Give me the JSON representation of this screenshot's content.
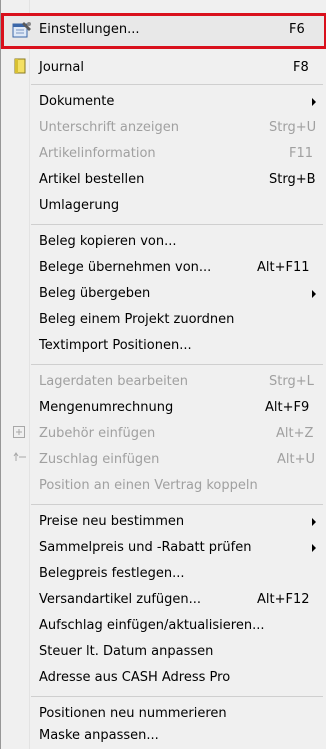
{
  "menu": {
    "items": [
      {
        "label": "Einstellungen...",
        "shortcut": "F6"
      },
      {
        "label": "Journal",
        "shortcut": "F8"
      },
      {
        "label": "Dokumente"
      },
      {
        "label": "Unterschrift anzeigen",
        "shortcut": "Strg+U"
      },
      {
        "label": "Artikelinformation",
        "shortcut": "F11"
      },
      {
        "label": "Artikel bestellen",
        "shortcut": "Strg+B"
      },
      {
        "label": "Umlagerung"
      },
      {
        "label": "Beleg kopieren von..."
      },
      {
        "label": "Belege übernehmen von...",
        "shortcut": "Alt+F11"
      },
      {
        "label": "Beleg übergeben"
      },
      {
        "label": "Beleg einem Projekt zuordnen"
      },
      {
        "label": "Textimport Positionen..."
      },
      {
        "label": "Lagerdaten bearbeiten",
        "shortcut": "Strg+L"
      },
      {
        "label": "Mengenumrechnung",
        "shortcut": "Alt+F9"
      },
      {
        "label": "Zubehör einfügen",
        "shortcut": "Alt+Z"
      },
      {
        "label": "Zuschlag einfügen",
        "shortcut": "Alt+U"
      },
      {
        "label": "Position an einen Vertrag koppeln"
      },
      {
        "label": "Preise neu bestimmen"
      },
      {
        "label": "Sammelpreis und -Rabatt prüfen"
      },
      {
        "label": "Belegpreis festlegen..."
      },
      {
        "label": "Versandartikel zufügen...",
        "shortcut": "Alt+F12"
      },
      {
        "label": "Aufschlag einfügen/aktualisieren..."
      },
      {
        "label": "Steuer lt. Datum anpassen"
      },
      {
        "label": "Adresse aus CASH Adress Pro"
      },
      {
        "label": "Positionen neu nummerieren"
      },
      {
        "label": "Maske anpassen..."
      }
    ]
  }
}
